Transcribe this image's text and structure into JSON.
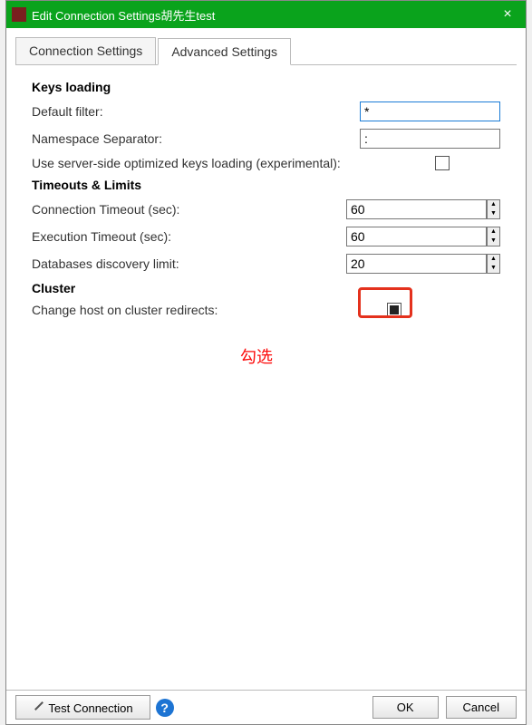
{
  "title": "Edit Connection Settings胡先生test",
  "close_x": "×",
  "tabs": {
    "connection": "Connection Settings",
    "advanced": "Advanced Settings"
  },
  "sections": {
    "keys_loading": "Keys loading",
    "timeouts_limits": "Timeouts & Limits",
    "cluster": "Cluster"
  },
  "labels": {
    "default_filter": "Default filter:",
    "namespace_sep": "Namespace Separator:",
    "use_server_side": "Use server-side optimized keys loading (experimental):",
    "conn_timeout": "Connection Timeout (sec):",
    "exec_timeout": "Execution Timeout (sec):",
    "db_discovery": "Databases discovery limit:",
    "change_host": "Change host on cluster redirects:"
  },
  "values": {
    "default_filter": "*",
    "namespace_sep": ":",
    "conn_timeout": "60",
    "exec_timeout": "60",
    "db_discovery": "20"
  },
  "annotation": "勾选",
  "footer": {
    "test": "Test Connection",
    "help": "?",
    "ok": "OK",
    "cancel": "Cancel"
  }
}
